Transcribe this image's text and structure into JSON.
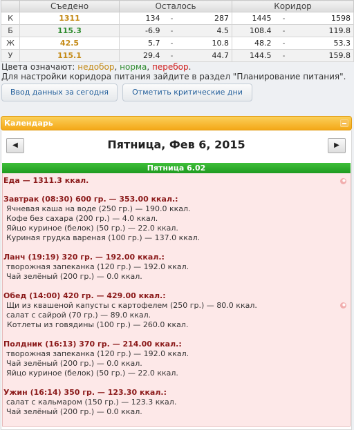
{
  "summary": {
    "headers": [
      "Съедено",
      "Осталось",
      "Коридор"
    ],
    "rows": [
      {
        "letter": "К",
        "eaten": "1311",
        "eaten_color": "#c48a16",
        "rem_lo": "134",
        "rem_hi": "287",
        "cor_lo": "1445",
        "cor_hi": "1598"
      },
      {
        "letter": "Б",
        "eaten": "115.3",
        "eaten_color": "#2e8b2e",
        "rem_lo": "-6.9",
        "rem_hi": "4.5",
        "cor_lo": "108.4",
        "cor_hi": "119.8"
      },
      {
        "letter": "Ж",
        "eaten": "42.5",
        "eaten_color": "#c48a16",
        "rem_lo": "5.7",
        "rem_hi": "10.8",
        "cor_lo": "48.2",
        "cor_hi": "53.3"
      },
      {
        "letter": "У",
        "eaten": "115.1",
        "eaten_color": "#c48a16",
        "rem_lo": "29.4",
        "rem_hi": "44.7",
        "cor_lo": "144.5",
        "cor_hi": "159.8"
      }
    ],
    "dash": "-"
  },
  "legend": {
    "prefix": "Цвета означают:",
    "under": "недобор",
    "sep": ",",
    "norm": "норма",
    "over": "перебор",
    "end": "."
  },
  "hint": "Для настройки коридора питания зайдите в раздел \"Планирование питания\".",
  "buttons": {
    "enter_today": "Ввод данных за сегодня",
    "mark_critical": "Отметить критические дни"
  },
  "calendar": {
    "title": "Календарь",
    "prev": "◀",
    "next": "▶",
    "date": "Пятница, Фев 6, 2015",
    "day_label": "Пятница 6.02"
  },
  "food": {
    "total": "Еда — 1311.3 ккал.",
    "meals": [
      {
        "title": "Завтрак (08:30) 600 гр. — 353.00 ккал.:",
        "items": [
          "Ячневая каша на воде (250 гр.) — 190.0 ккал.",
          "Кофе без сахара (200 гр.) — 4.0 ккал.",
          "Яйцо куриное (белок) (50 гр.) — 22.0 ккал.",
          "Куриная грудка вареная (100 гр.) — 137.0 ккал."
        ]
      },
      {
        "title": "Ланч (19:19) 320 гр. — 192.00 ккал.:",
        "items": [
          "творожная запеканка (120 гр.) — 192.0 ккал.",
          "Чай зелёный (200 гр.) — 0.0 ккал."
        ]
      },
      {
        "title": "Обед (14:00) 420 гр. — 429.00 ккал.:",
        "items": [
          "Щи из квашеной капусты с картофелем (250 гр.) — 80.0 ккал.",
          "салат с сайрой (70 гр.) — 89.0 ккал.",
          "Котлеты из говядины (100 гр.) — 260.0 ккал."
        ]
      },
      {
        "title": "Полдник (16:13) 370 гр. — 214.00 ккал.:",
        "items": [
          "творожная запеканка (120 гр.) — 192.0 ккал.",
          "Чай зелёный (200 гр.) — 0.0 ккал.",
          "Яйцо куриное (белок) (50 гр.) — 22.0 ккал."
        ]
      },
      {
        "title": "Ужин (16:14) 350 гр. — 123.30 ккал.:",
        "items": [
          "салат с кальмаром (150 гр.) — 123.3 ккал.",
          "Чай зелёный (200 гр.) — 0.0 ккал."
        ]
      }
    ]
  }
}
